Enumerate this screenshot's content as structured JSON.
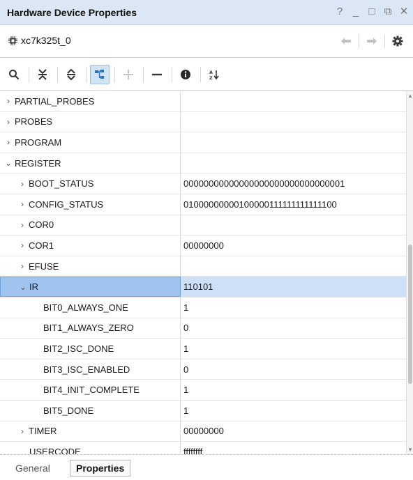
{
  "window": {
    "title": "Hardware Device Properties",
    "controls": [
      "?",
      "_",
      "□",
      "⧉",
      "✕"
    ]
  },
  "device": {
    "name": "xc7k325t_0",
    "icon": "chip-icon"
  },
  "toolbar": {
    "icons": [
      "search-icon",
      "collapse-all-icon",
      "expand-all-icon",
      "tree-view-icon",
      "add-icon",
      "remove-icon",
      "info-icon",
      "sort-az-icon"
    ]
  },
  "rows": [
    {
      "name": "PARTIAL_PROBES",
      "value": "",
      "expander": "›"
    },
    {
      "name": "PROBES",
      "value": "",
      "expander": "›"
    },
    {
      "name": "PROGRAM",
      "value": "",
      "expander": "›"
    },
    {
      "name": "REGISTER",
      "value": "",
      "expander": "⌄"
    },
    {
      "name": "BOOT_STATUS",
      "value": "00000000000000000000000000000001",
      "expander": "›"
    },
    {
      "name": "CONFIG_STATUS",
      "value": "01000000000100000111111111111100",
      "expander": "›"
    },
    {
      "name": "COR0",
      "value": "",
      "expander": "›"
    },
    {
      "name": "COR1",
      "value": "00000000",
      "expander": "›"
    },
    {
      "name": "EFUSE",
      "value": "",
      "expander": "›"
    },
    {
      "name": "IR",
      "value": "110101",
      "expander": "⌄"
    },
    {
      "name": "BIT0_ALWAYS_ONE",
      "value": "1",
      "expander": ""
    },
    {
      "name": "BIT1_ALWAYS_ZERO",
      "value": "0",
      "expander": ""
    },
    {
      "name": "BIT2_ISC_DONE",
      "value": "1",
      "expander": ""
    },
    {
      "name": "BIT3_ISC_ENABLED",
      "value": "0",
      "expander": ""
    },
    {
      "name": "BIT4_INIT_COMPLETE",
      "value": "1",
      "expander": ""
    },
    {
      "name": "BIT5_DONE",
      "value": "1",
      "expander": ""
    },
    {
      "name": "TIMER",
      "value": "00000000",
      "expander": "›"
    },
    {
      "name": "USERCODE",
      "value": "ffffffff",
      "expander": ""
    }
  ],
  "tabs": {
    "general": "General",
    "properties": "Properties"
  },
  "colors": {
    "title_bg": "#dce7f5",
    "selected_row": "#cde0f7",
    "selected_cell": "#9fc4ee",
    "accent_icon": "#2f6fb5"
  }
}
